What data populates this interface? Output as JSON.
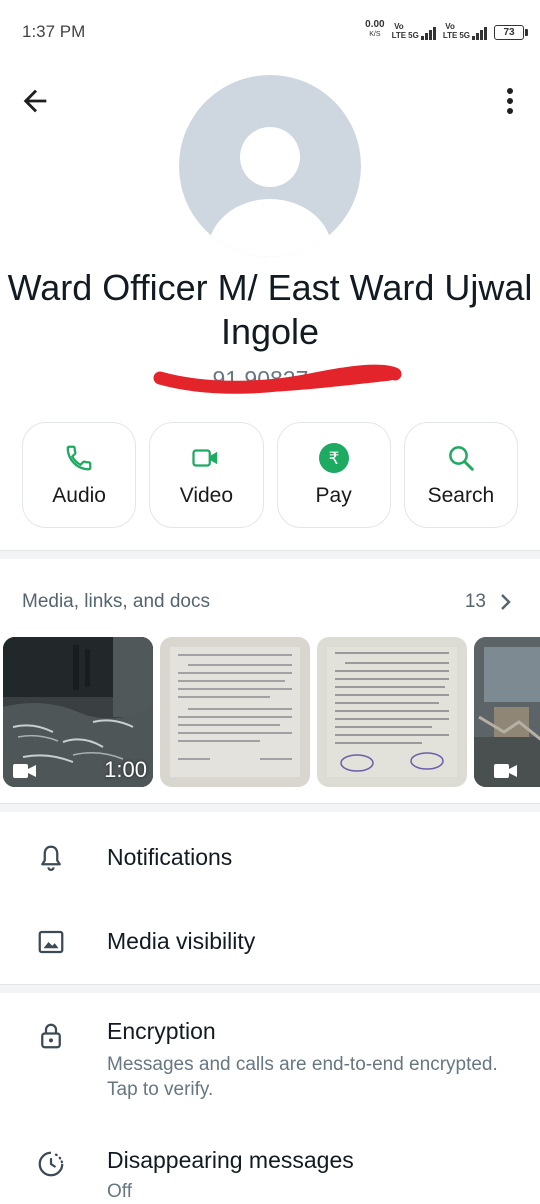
{
  "status": {
    "time": "1:37 PM",
    "net_speed_value": "0.00",
    "net_speed_unit": "K/S",
    "sim1_label_top": "Vo",
    "sim1_label_bottom": "LTE",
    "sim1_gen": "5G",
    "sim2_label_top": "Vo",
    "sim2_label_bottom": "LTE",
    "sim2_gen": "5G",
    "battery": "73"
  },
  "contact": {
    "name": "Ward Officer M/ East Ward Ujwal Ingole",
    "phone_partial": "91 90827 4"
  },
  "actions": [
    {
      "label": "Audio",
      "icon": "phone-icon"
    },
    {
      "label": "Video",
      "icon": "video-camera-icon"
    },
    {
      "label": "Pay",
      "icon": "rupee-icon"
    },
    {
      "label": "Search",
      "icon": "search-icon"
    }
  ],
  "media": {
    "title": "Media, links, and docs",
    "count": "13",
    "video_duration": "1:00"
  },
  "settings": {
    "notifications": "Notifications",
    "media_visibility": "Media visibility",
    "encryption_title": "Encryption",
    "encryption_sub": "Messages and calls are end-to-end encrypted. Tap to verify.",
    "disappearing_title": "Disappearing messages",
    "disappearing_sub": "Off"
  },
  "colors": {
    "accent_green": "#1daa61",
    "redaction_red": "#e3242b"
  }
}
